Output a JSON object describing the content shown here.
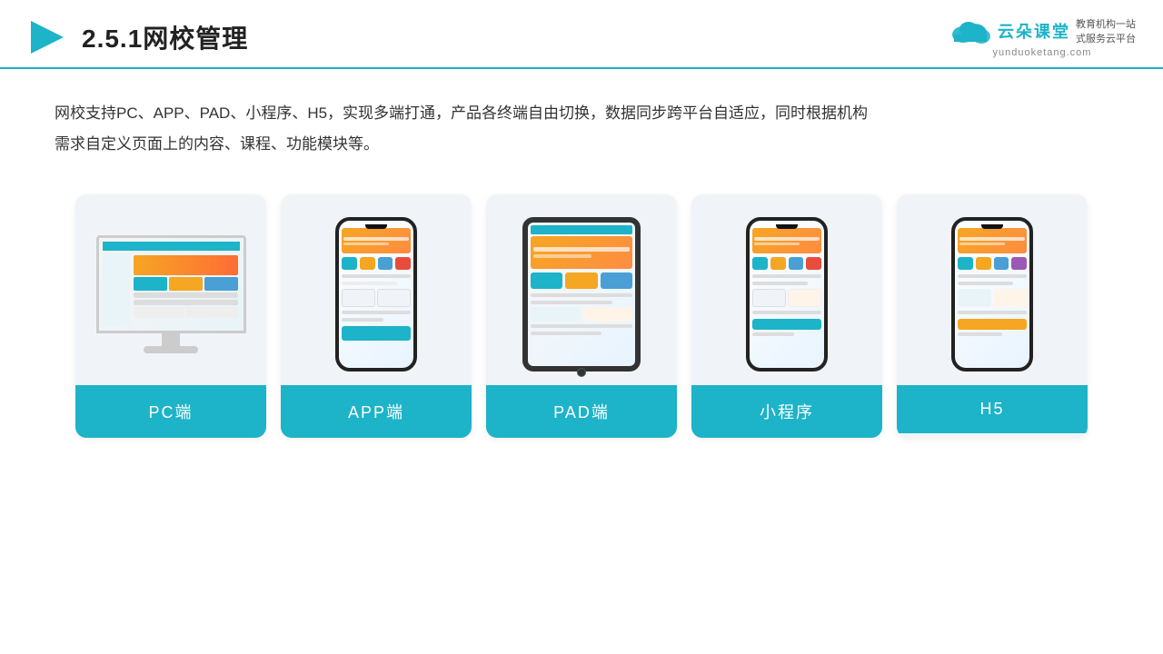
{
  "header": {
    "title": "2.5.1网校管理",
    "logo_name": "云朵课堂",
    "logo_url": "yunduoketang.com",
    "logo_slogan": "教育机构一站\n式服务云平台"
  },
  "description": {
    "text": "网校支持PC、APP、PAD、小程序、H5，实现多端打通，产品各终端自由切换，数据同步跨平台自适应，同时根据机构需求自定义页面上的内容、课程、功能模块等。"
  },
  "cards": [
    {
      "id": "pc",
      "label": "PC端"
    },
    {
      "id": "app",
      "label": "APP端"
    },
    {
      "id": "pad",
      "label": "PAD端"
    },
    {
      "id": "miniprogram",
      "label": "小程序"
    },
    {
      "id": "h5",
      "label": "H5"
    }
  ]
}
